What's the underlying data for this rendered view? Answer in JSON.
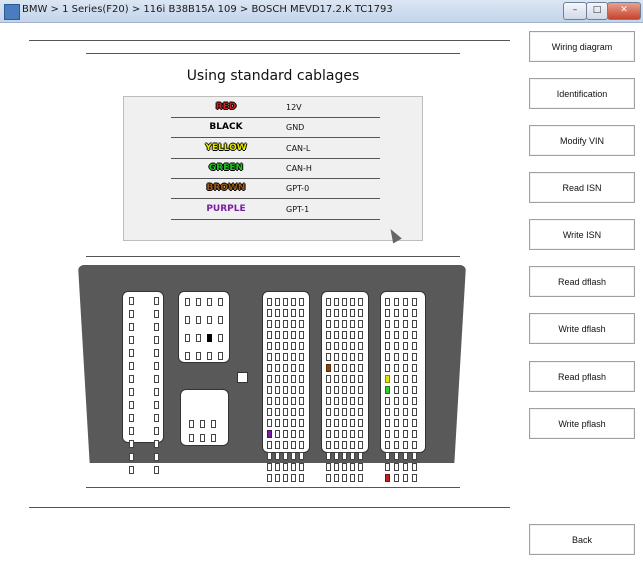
{
  "window": {
    "title": "BMW > 1 Series(F20) > 116i B38B15A 109 > BOSCH MEVD17.2.K TC1793"
  },
  "heading": "Using  standard cablages",
  "legend": [
    {
      "color_name": "RED",
      "signal": "12V",
      "color": "#c8201e"
    },
    {
      "color_name": "BLACK",
      "signal": "GND",
      "color": "#000000"
    },
    {
      "color_name": "YELLOW",
      "signal": "CAN-L",
      "color": "#e8e800"
    },
    {
      "color_name": "GREEN",
      "signal": "CAN-H",
      "color": "#1fc81f"
    },
    {
      "color_name": "BROWN",
      "signal": "GPT-0",
      "color": "#9a5a14"
    },
    {
      "color_name": "PURPLE",
      "signal": "GPT-1",
      "color": "#7a1fa0"
    }
  ],
  "buttons": {
    "wiring_diagram": "Wiring diagram",
    "identification": "Identification",
    "modify_vin": "Modify VIN",
    "read_isn": "Read  ISN",
    "write_isn": "Write  ISN",
    "read_dflash": "Read dflash",
    "write_dflash": "Write dflash",
    "read_pflash": "Read pflash",
    "write_pflash": "Write pflash",
    "back": "Back"
  }
}
